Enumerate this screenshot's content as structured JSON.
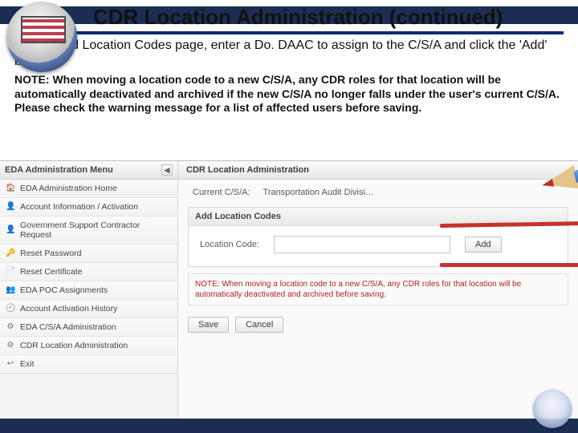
{
  "slide": {
    "title": "CDR Location Administration (continued)",
    "intro": "On the Add Location Codes page, enter a Do. DAAC to assign to the C/S/A and click the 'Add' button.",
    "note": "NOTE: When moving a location code to a new C/S/A, any CDR roles for that location will be automatically deactivated and archived if the new C/S/A no longer falls under the user's current C/S/A. Please check the warning message for a list of affected users before saving."
  },
  "app": {
    "sidebar": {
      "title": "EDA Administration Menu",
      "items": [
        {
          "icon": "🏠",
          "label": "EDA Administration Home"
        },
        {
          "icon": "👤",
          "label": "Account Information / Activation"
        },
        {
          "icon": "👤",
          "label": "Government Support Contractor Request"
        },
        {
          "icon": "🔑",
          "label": "Reset Password"
        },
        {
          "icon": "📄",
          "label": "Reset Certificate"
        },
        {
          "icon": "👥",
          "label": "EDA POC Assignments"
        },
        {
          "icon": "🕘",
          "label": "Account Activation History"
        },
        {
          "icon": "⚙",
          "label": "EDA C/S/A Administration"
        },
        {
          "icon": "⚙",
          "label": "CDR Location Administration"
        },
        {
          "icon": "↩",
          "label": "Exit"
        }
      ]
    },
    "main": {
      "page_title": "CDR Location Administration",
      "csa_label": "Current C/S/A:",
      "csa_value": "Transportation Audit Divisi…",
      "panel_title": "Add Location Codes",
      "field_label": "Location Code:",
      "field_value": "",
      "add_label": "Add",
      "warning": "NOTE: When moving a location code to a new C/S/A, any CDR roles for that location will be automatically deactivated and archived before saving.",
      "save_label": "Save",
      "cancel_label": "Cancel"
    }
  }
}
